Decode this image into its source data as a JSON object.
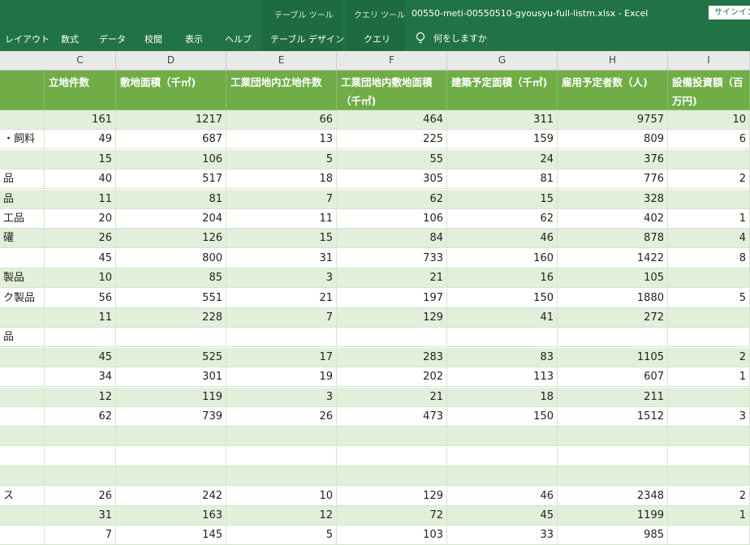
{
  "ribbon": {
    "context_tabs": [
      {
        "name": "テーブル ツール"
      },
      {
        "name": "クエリ ツール"
      }
    ],
    "window_title": "00550-meti-00550510-gyousyu-full-listm.xlsx  -  Excel",
    "signin": "サインイン",
    "tabs": [
      "レイアウト",
      "数式",
      "データ",
      "校閲",
      "表示",
      "ヘルプ",
      "テーブル デザイン",
      "クエリ"
    ],
    "search_placeholder": "何をしますか"
  },
  "columns": [
    "C",
    "D",
    "E",
    "F",
    "G",
    "H",
    "I"
  ],
  "header": [
    "立地件数",
    "敷地面積（千㎡)",
    "工業団地内立地件数",
    "工業団地内敷地面積（千㎡)",
    "建築予定面積（千㎡)",
    "雇用予定者数（人)",
    "設備投資額（百万円)"
  ],
  "rows": [
    {
      "label": "",
      "values": [
        "161",
        "1217",
        "66",
        "464",
        "311",
        "9757",
        "10"
      ]
    },
    {
      "label": "・飼料",
      "values": [
        "49",
        "687",
        "13",
        "225",
        "159",
        "809",
        "6"
      ]
    },
    {
      "label": "",
      "values": [
        "15",
        "106",
        "5",
        "55",
        "24",
        "376",
        ""
      ]
    },
    {
      "label": "品",
      "values": [
        "40",
        "517",
        "18",
        "305",
        "81",
        "776",
        "2"
      ]
    },
    {
      "label": "品",
      "values": [
        "11",
        "81",
        "7",
        "62",
        "15",
        "328",
        ""
      ]
    },
    {
      "label": "工品",
      "values": [
        "20",
        "204",
        "11",
        "106",
        "62",
        "402",
        "1"
      ]
    },
    {
      "label": "礶",
      "values": [
        "26",
        "126",
        "15",
        "84",
        "46",
        "878",
        "4"
      ]
    },
    {
      "label": "",
      "values": [
        "45",
        "800",
        "31",
        "733",
        "160",
        "1422",
        "8"
      ]
    },
    {
      "label": "製品",
      "values": [
        "10",
        "85",
        "3",
        "21",
        "16",
        "105",
        ""
      ]
    },
    {
      "label": "ク製品",
      "values": [
        "56",
        "551",
        "21",
        "197",
        "150",
        "1880",
        "5"
      ]
    },
    {
      "label": "",
      "values": [
        "11",
        "228",
        "7",
        "129",
        "41",
        "272",
        ""
      ]
    },
    {
      "label": "品",
      "values": [
        "",
        "",
        "",
        "",
        "",
        "",
        ""
      ]
    },
    {
      "label": "",
      "values": [
        "45",
        "525",
        "17",
        "283",
        "83",
        "1105",
        "2"
      ]
    },
    {
      "label": "",
      "values": [
        "34",
        "301",
        "19",
        "202",
        "113",
        "607",
        "1"
      ]
    },
    {
      "label": "",
      "values": [
        "12",
        "119",
        "3",
        "21",
        "18",
        "211",
        ""
      ]
    },
    {
      "label": "",
      "values": [
        "62",
        "739",
        "26",
        "473",
        "150",
        "1512",
        "3"
      ]
    },
    {
      "label": "",
      "values": [
        "",
        "",
        "",
        "",
        "",
        "",
        ""
      ]
    },
    {
      "label": "",
      "values": [
        "",
        "",
        "",
        "",
        "",
        "",
        ""
      ]
    },
    {
      "label": "",
      "values": [
        "",
        "",
        "",
        "",
        "",
        "",
        ""
      ]
    },
    {
      "label": "ス",
      "values": [
        "26",
        "242",
        "10",
        "129",
        "46",
        "2348",
        "2"
      ]
    },
    {
      "label": "",
      "values": [
        "31",
        "163",
        "12",
        "72",
        "45",
        "1199",
        "1"
      ]
    },
    {
      "label": "",
      "values": [
        "7",
        "145",
        "5",
        "103",
        "33",
        "985",
        ""
      ]
    }
  ]
}
